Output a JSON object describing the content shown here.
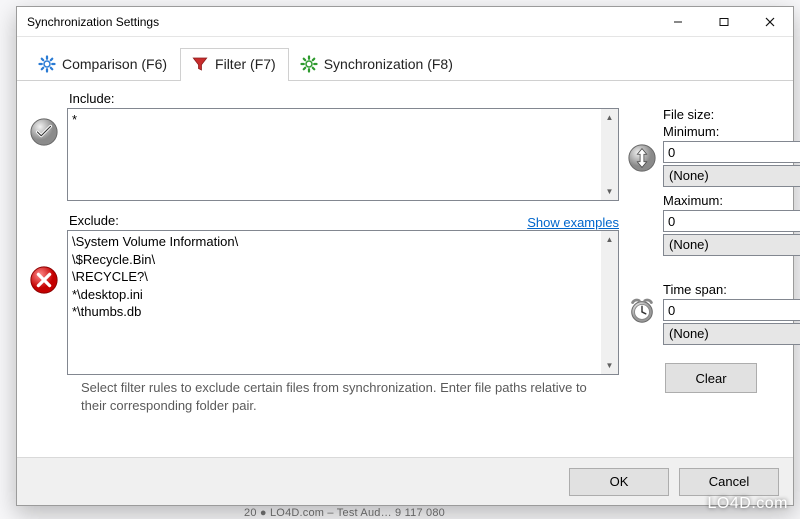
{
  "window": {
    "title": "Synchronization Settings"
  },
  "tabs": {
    "comparison": "Comparison (F6)",
    "filter": "Filter (F7)",
    "synchronization": "Synchronization (F8)"
  },
  "include": {
    "label": "Include:",
    "value": "*"
  },
  "exclude": {
    "label": "Exclude:",
    "examples_link": "Show examples",
    "value": "\\System Volume Information\\\n\\$Recycle.Bin\\\n\\RECYCLE?\\\n*\\desktop.ini\n*\\thumbs.db"
  },
  "help_text": "Select filter rules to exclude certain files from synchronization. Enter file paths relative to their corresponding folder pair.",
  "filesize": {
    "title": "File size:",
    "min_label": "Minimum:",
    "min_value": "0",
    "min_unit": "(None)",
    "max_label": "Maximum:",
    "max_value": "0",
    "max_unit": "(None)"
  },
  "timespan": {
    "title": "Time span:",
    "value": "0",
    "unit": "(None)"
  },
  "buttons": {
    "clear": "Clear",
    "ok": "OK",
    "cancel": "Cancel"
  },
  "watermark": "LO4D.com",
  "backdrop_hint": "20 ● LO4D.com – Test Aud…   9 117 080"
}
